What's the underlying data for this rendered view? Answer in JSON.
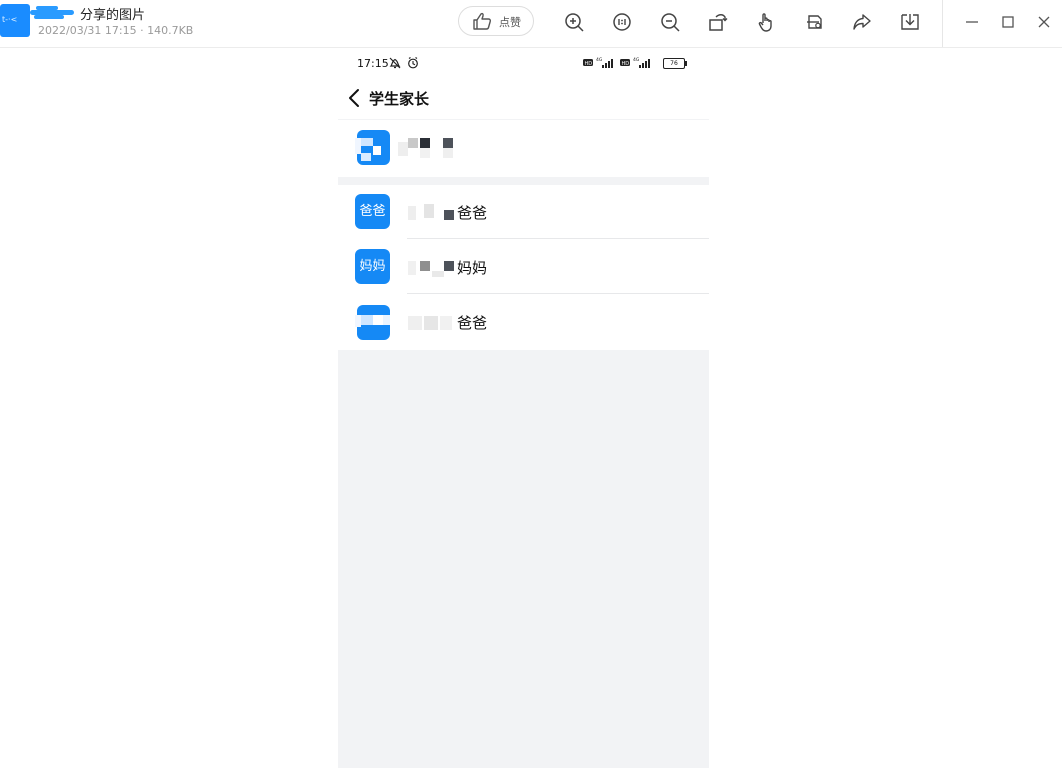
{
  "viewer": {
    "file_title": "分享的图片",
    "file_meta": "2022/03/31 17:15 · 140.7KB",
    "like_label": "点赞",
    "toolbar_icons": [
      "zoom-in-icon",
      "actual-size-icon",
      "zoom-out-icon",
      "rotate-icon",
      "hand-tool-icon",
      "ocr-icon",
      "share-icon",
      "download-icon"
    ],
    "window_icons": [
      "minimize-icon",
      "maximize-icon",
      "close-icon"
    ]
  },
  "phone": {
    "status_time": "17:15",
    "battery_level": "76",
    "page_title": "学生家长",
    "parents": [
      {
        "avatar_label": "爸爸",
        "name_suffix": "爸爸"
      },
      {
        "avatar_label": "妈妈",
        "name_suffix": "妈妈"
      },
      {
        "avatar_label": "",
        "name_suffix": "爸爸"
      }
    ]
  },
  "colors": {
    "accent_blue": "#1589f5",
    "background_gray": "#f2f3f5"
  }
}
